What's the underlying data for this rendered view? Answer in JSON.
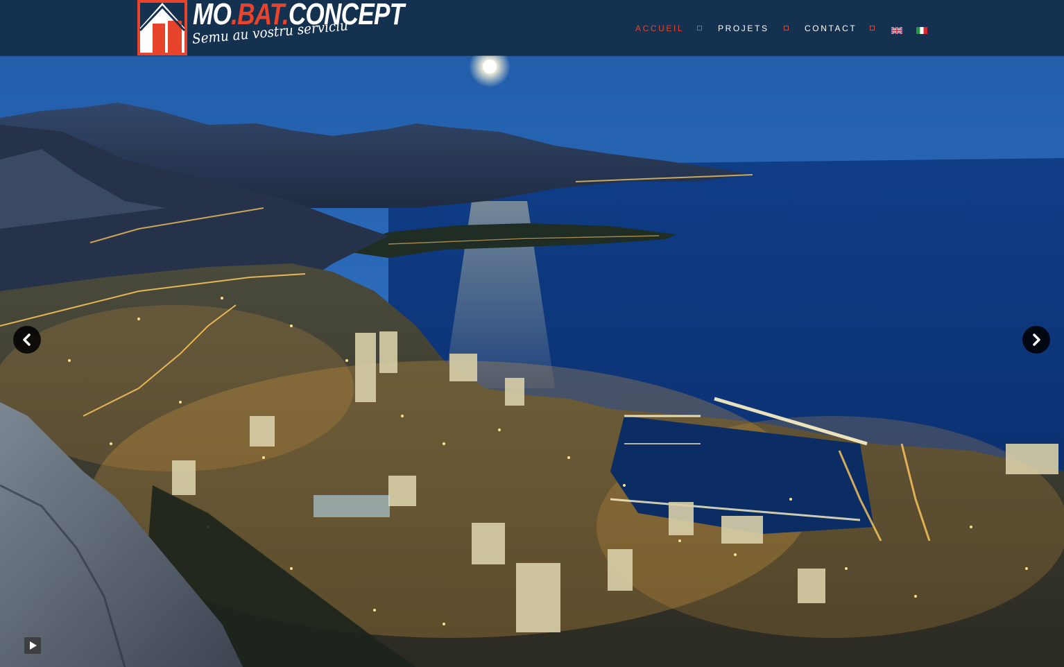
{
  "brand": {
    "name_part1": "MO",
    "name_dot1": ".",
    "name_part2": "BAT",
    "name_dot2": ".",
    "name_part3": "CONCEPT",
    "tagline": "Semu au vostru serviciu",
    "accent_color": "#e8442c"
  },
  "nav": {
    "items": [
      {
        "label": "ACCUEIL",
        "active": true
      },
      {
        "label": "PROJETS",
        "active": false
      },
      {
        "label": "CONTACT",
        "active": false
      }
    ],
    "languages": [
      {
        "code": "en",
        "icon": "uk-flag-icon"
      },
      {
        "code": "it",
        "icon": "italy-flag-icon"
      }
    ]
  },
  "slider": {
    "prev_icon": "chevron-left-icon",
    "next_icon": "chevron-right-icon",
    "play_icon": "play-icon"
  },
  "colors": {
    "header_bg": "#143150",
    "active_nav": "#e8442c",
    "separator": "#e8442c"
  }
}
